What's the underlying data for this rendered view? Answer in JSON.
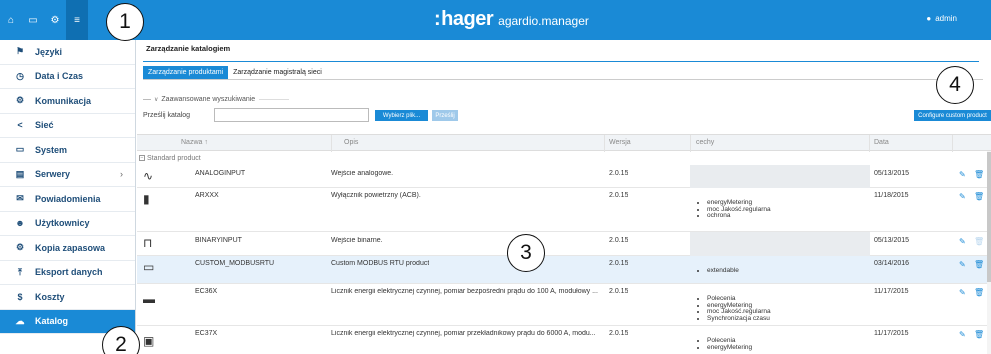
{
  "topbar": {
    "brand": "hager",
    "app_name": "agardio.manager",
    "user": "admin",
    "nav": [
      {
        "icon": "home-icon",
        "glyph": "⌂"
      },
      {
        "icon": "monitor-icon",
        "glyph": "▭"
      },
      {
        "icon": "gears-icon",
        "glyph": "⚙"
      },
      {
        "icon": "sliders-icon",
        "glyph": "≡"
      }
    ]
  },
  "callouts": [
    "1",
    "2",
    "3",
    "4"
  ],
  "sidebar": {
    "items": [
      {
        "label": "Języki",
        "glyph": "⚑"
      },
      {
        "label": "Data i Czas",
        "glyph": "◷"
      },
      {
        "label": "Komunikacja",
        "glyph": "⚙"
      },
      {
        "label": "Sieć",
        "glyph": "<"
      },
      {
        "label": "System",
        "glyph": "▭"
      },
      {
        "label": "Serwery",
        "glyph": "▤",
        "chevron": "›"
      },
      {
        "label": "Powiadomienia",
        "glyph": "✉"
      },
      {
        "label": "Użytkownicy",
        "glyph": "☻"
      },
      {
        "label": "Kopia zapasowa",
        "glyph": "⚙"
      },
      {
        "label": "Eksport danych",
        "glyph": "⤒"
      },
      {
        "label": "Koszty",
        "glyph": "$"
      },
      {
        "label": "Katalog",
        "glyph": "☁"
      }
    ],
    "active_index": 11
  },
  "main": {
    "title": "Zarządzanie katalogiem",
    "tabs": [
      {
        "label": "Zarządzanie produktami",
        "active": true
      },
      {
        "label": "Zarządzanie magistralą sieci",
        "active": false
      }
    ],
    "advanced": {
      "legend": "Zaawansowane wyszukiwanie",
      "browse_label": "Prześlij katalog",
      "browse_value": "",
      "choose_button": "Wybierz plik...",
      "import_button": "Prześlij"
    },
    "configure_button": "Configure custom product"
  },
  "table": {
    "columns": {
      "name": "Nazwa ↑",
      "desc": "Opis",
      "version": "Wersja",
      "features": "cechy",
      "date": "Data"
    },
    "group_label": "Standard product",
    "rows": [
      {
        "name": "ANALOGINPUT",
        "desc": "Wejście analogowe.",
        "version": "2.0.15",
        "features": [],
        "date": "05/13/2015",
        "icon": "analog-wave-icon",
        "glyph": "∿",
        "deletable": true
      },
      {
        "name": "ARXXX",
        "desc": "Wyłącznik powietrzny (ACB).",
        "version": "2.0.15",
        "features": [
          "energyMetering",
          "moc Jakość.regularna",
          "ochrona"
        ],
        "date": "11/18/2015",
        "icon": "breaker-icon",
        "glyph": "▮",
        "deletable": true
      },
      {
        "name": "BINARYINPUT",
        "desc": "Wejście binarne.",
        "version": "2.0.15",
        "features": [],
        "date": "05/13/2015",
        "icon": "binary-pulse-icon",
        "glyph": "⊓",
        "deletable": false
      },
      {
        "name": "CUSTOM_MODBUSRTU",
        "desc": "Custom MODBUS RTU product",
        "version": "2.0.15",
        "features": [
          "extendable"
        ],
        "date": "03/14/2016",
        "icon": "custom-device-icon",
        "glyph": "▭",
        "deletable": true
      },
      {
        "name": "EC36X",
        "desc": "Licznik energii elektrycznej czynnej, pomiar bezpośredni prądu do 100 A, modułowy ...",
        "version": "2.0.15",
        "features": [
          "Polecenia",
          "energyMetering",
          "moc Jakość.regularna",
          "Synchronizacja czasu"
        ],
        "date": "11/17/2015",
        "icon": "meter-icon",
        "glyph": "▬",
        "deletable": true
      },
      {
        "name": "EC37X",
        "desc": "Licznik energii elektrycznej czynnej, pomiar przekładnikowy prądu do 6000 A, modu...",
        "version": "2.0.15",
        "features": [
          "Polecenia",
          "energyMetering"
        ],
        "date": "11/17/2015",
        "icon": "meter-icon",
        "glyph": "▣",
        "deletable": true
      }
    ]
  },
  "actions": {
    "edit_glyph": "✎",
    "delete_glyph": "🗑"
  },
  "colors": {
    "primary": "#1a8ad6",
    "row_highlight": "#e6f1fb"
  }
}
